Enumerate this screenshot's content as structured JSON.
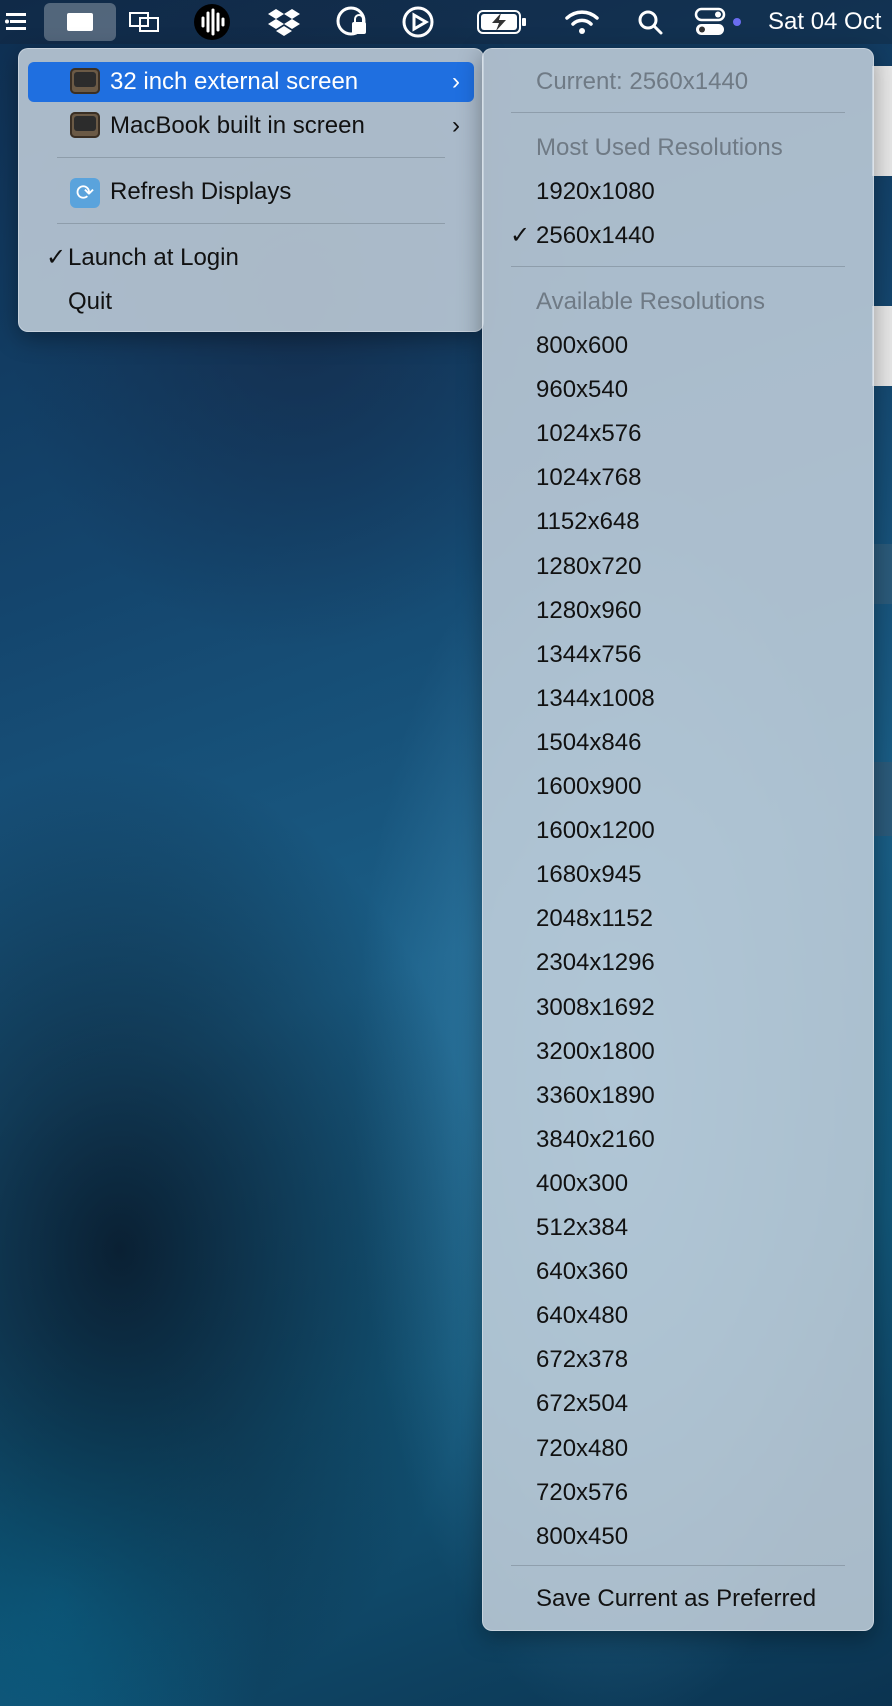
{
  "menubar": {
    "date": "Sat 04 Oct",
    "icons": [
      "list-menu-icon",
      "display-icon",
      "screens-icon",
      "audio-waveform-icon",
      "dropbox-icon",
      "vpn-lock-icon",
      "play-circle-icon",
      "battery-charging-icon",
      "wifi-icon",
      "search-icon",
      "control-center-icon",
      "indicator-dot-icon"
    ]
  },
  "main_menu": {
    "items": [
      {
        "label": "32 inch external screen",
        "icon": "tv-icon",
        "submenu": true,
        "highlighted": true
      },
      {
        "label": "MacBook built in screen",
        "icon": "tv-icon",
        "submenu": true,
        "highlighted": false
      }
    ],
    "refresh_label": "Refresh Displays",
    "launch_label": "Launch at Login",
    "launch_checked": "✓",
    "quit_label": "Quit"
  },
  "sub_menu": {
    "current": "Current: 2560x1440",
    "most_used_header": "Most Used Resolutions",
    "most_used": [
      {
        "label": "1920x1080",
        "checked": false
      },
      {
        "label": "2560x1440",
        "checked": true
      }
    ],
    "available_header": "Available Resolutions",
    "available": [
      "800x600",
      "960x540",
      "1024x576",
      "1024x768",
      "1152x648",
      "1280x720",
      "1280x960",
      "1344x756",
      "1344x1008",
      "1504x846",
      "1600x900",
      "1600x1200",
      "1680x945",
      "2048x1152",
      "2304x1296",
      "3008x1692",
      "3200x1800",
      "3360x1890",
      "3840x2160",
      "400x300",
      "512x384",
      "640x360",
      "640x480",
      "672x378",
      "672x504",
      "720x480",
      "720x576",
      "800x450"
    ],
    "save_label": "Save Current as Preferred"
  },
  "colors": {
    "highlight": "#1f6fe0",
    "menu_bg": "#c4d0dc"
  }
}
